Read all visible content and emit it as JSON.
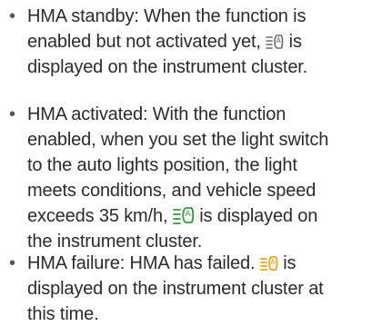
{
  "colors": {
    "text": "#2b2b2b",
    "icon_neutral": "#6b6b6b",
    "icon_active": "#2f9a3e",
    "icon_failure": "#f2a30f"
  },
  "icons": {
    "standby": "hma-indicator-gray-icon",
    "activated": "hma-indicator-green-icon",
    "failure": "hma-indicator-amber-icon"
  },
  "items": [
    {
      "lines": [
        "HMA standby: When the function is",
        "enabled but not activated yet,",
        "is",
        "displayed on the instrument cluster."
      ]
    },
    {
      "lines": [
        "HMA activated: With the function",
        "enabled, when you set the light switch",
        "to the auto lights position, the light",
        "meets conditions, and vehicle speed",
        "exceeds 35 km/h,",
        "is displayed on",
        "the instrument cluster."
      ]
    },
    {
      "lines": [
        "HMA failure: HMA has failed.",
        "is",
        "displayed on the instrument cluster at",
        "this time."
      ]
    }
  ]
}
